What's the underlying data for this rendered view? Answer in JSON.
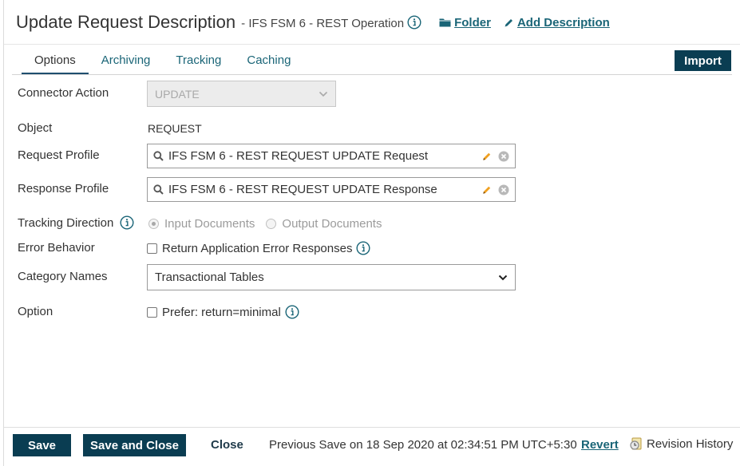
{
  "header": {
    "title": "Update Request Description",
    "subtitle": "- IFS FSM 6 - REST Operation",
    "folder_label": "Folder",
    "add_description_label": "Add Description"
  },
  "tabs": [
    {
      "label": "Options",
      "active": true
    },
    {
      "label": "Archiving",
      "active": false
    },
    {
      "label": "Tracking",
      "active": false
    },
    {
      "label": "Caching",
      "active": false
    }
  ],
  "import_label": "Import",
  "form": {
    "connector_action": {
      "label": "Connector Action",
      "value": "UPDATE"
    },
    "object": {
      "label": "Object",
      "value": "REQUEST"
    },
    "request_profile": {
      "label": "Request Profile",
      "value": "IFS FSM 6 - REST REQUEST UPDATE Request"
    },
    "response_profile": {
      "label": "Response Profile",
      "value": "IFS FSM 6 - REST REQUEST UPDATE Response"
    },
    "tracking_direction": {
      "label": "Tracking Direction",
      "option_input": "Input Documents",
      "option_output": "Output Documents",
      "selected": "Input Documents"
    },
    "error_behavior": {
      "label": "Error Behavior",
      "checkbox_label": "Return Application Error Responses",
      "checked": false
    },
    "category_names": {
      "label": "Category Names",
      "value": "Transactional Tables"
    },
    "option": {
      "label": "Option",
      "checkbox_label": "Prefer: return=minimal",
      "checked": false
    }
  },
  "footer": {
    "save_label": "Save",
    "save_close_label": "Save and Close",
    "close_label": "Close",
    "status": "Previous Save on 18 Sep 2020 at 02:34:51 PM UTC+5:30",
    "revert_label": "Revert",
    "revision_history_label": "Revision History"
  },
  "colors": {
    "primary_button": "#0a3d52",
    "link": "#1a6577",
    "pencil": "#f0a020"
  },
  "icons": [
    "info-icon",
    "folder-icon",
    "pencil-icon",
    "search-icon",
    "edit-icon",
    "clear-icon",
    "chevron-down-icon",
    "revision-history-icon"
  ]
}
